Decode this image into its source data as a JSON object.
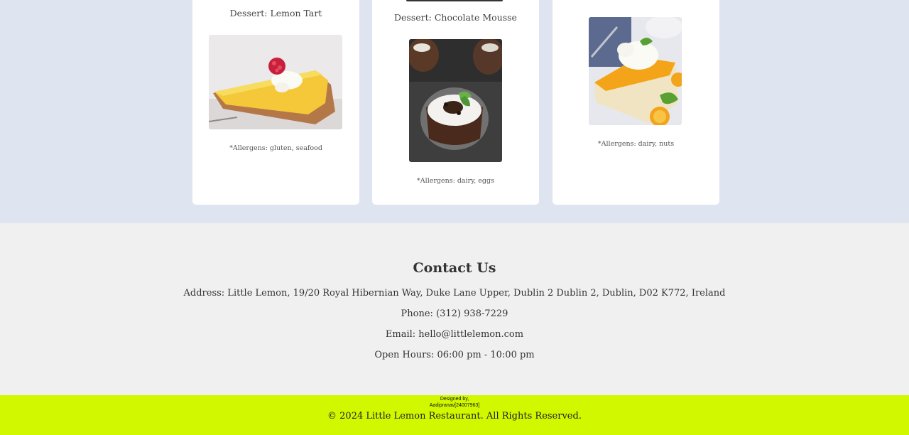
{
  "menu": {
    "cards": [
      {
        "title": "Dessert: Lemon Tart",
        "allergens": "*Allergens: gluten, seafood",
        "image": "lemon-tart-photo"
      },
      {
        "title": "Dessert: Chocolate Mousse",
        "allergens": "*Allergens: dairy, eggs",
        "image": "chocolate-mousse-photo"
      },
      {
        "title": "",
        "allergens": "*Allergens: dairy, nuts",
        "image": "orange-cheesecake-photo"
      }
    ]
  },
  "contact": {
    "heading": "Contact Us",
    "address": "Address: Little Lemon, 19/20 Royal Hibernian Way, Duke Lane Upper, Dublin 2 Dublin 2, Dublin, D02 K772, Ireland",
    "phone": "Phone: (312) 938-7229",
    "email": "Email: hello@littlelemon.com",
    "hours": "Open Hours: 06:00 pm - 10:00 pm"
  },
  "footer": {
    "designed_line1": "Designed by,",
    "designed_line2": "Aadipranav[24007963]",
    "copyright": "© 2024 Little Lemon Restaurant. All Rights Reserved."
  },
  "colors": {
    "menu_bg": "#dee4f0",
    "contact_bg": "#f0f0f0",
    "footer_bg": "#d2f800"
  }
}
